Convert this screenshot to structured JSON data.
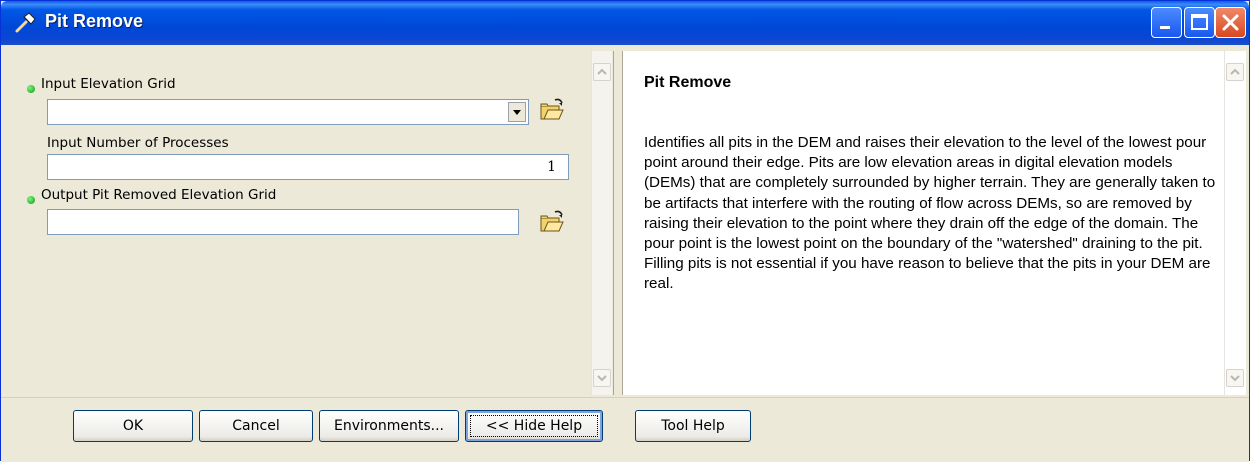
{
  "window": {
    "title": "Pit Remove",
    "title_icon": "hammer-icon",
    "controls": [
      "minimize-icon",
      "maximize-icon",
      "close-icon"
    ]
  },
  "form": {
    "input_elevation_grid": {
      "label": "Input Elevation Grid",
      "value": "",
      "required": true
    },
    "input_number_processes": {
      "label": "Input Number of Processes",
      "value": "1",
      "required": false
    },
    "output_grid": {
      "label": "Output Pit Removed Elevation Grid",
      "value": "",
      "required": true
    }
  },
  "help": {
    "title": "Pit Remove",
    "body": "Identifies all pits in the DEM and raises their elevation to the level of the lowest pour point around their edge. Pits are low elevation areas in digital elevation models (DEMs) that are completely surrounded by higher terrain. They are generally taken to be artifacts that interfere with the routing of flow across DEMs, so are removed by raising their elevation to the point where they drain off the edge of the domain. The pour point is the lowest point on the boundary of the \"watershed\" draining to the pit. Filling pits is not essential if you have reason to believe that the pits in your DEM are real."
  },
  "buttons": {
    "ok": "OK",
    "cancel": "Cancel",
    "environments": "Environments...",
    "hide_help": "<< Hide Help",
    "tool_help": "Tool Help"
  },
  "colors": {
    "title_bar": "#0054e3",
    "required_dot": "#1bb21b",
    "dialog_bg": "#ece9d8"
  }
}
